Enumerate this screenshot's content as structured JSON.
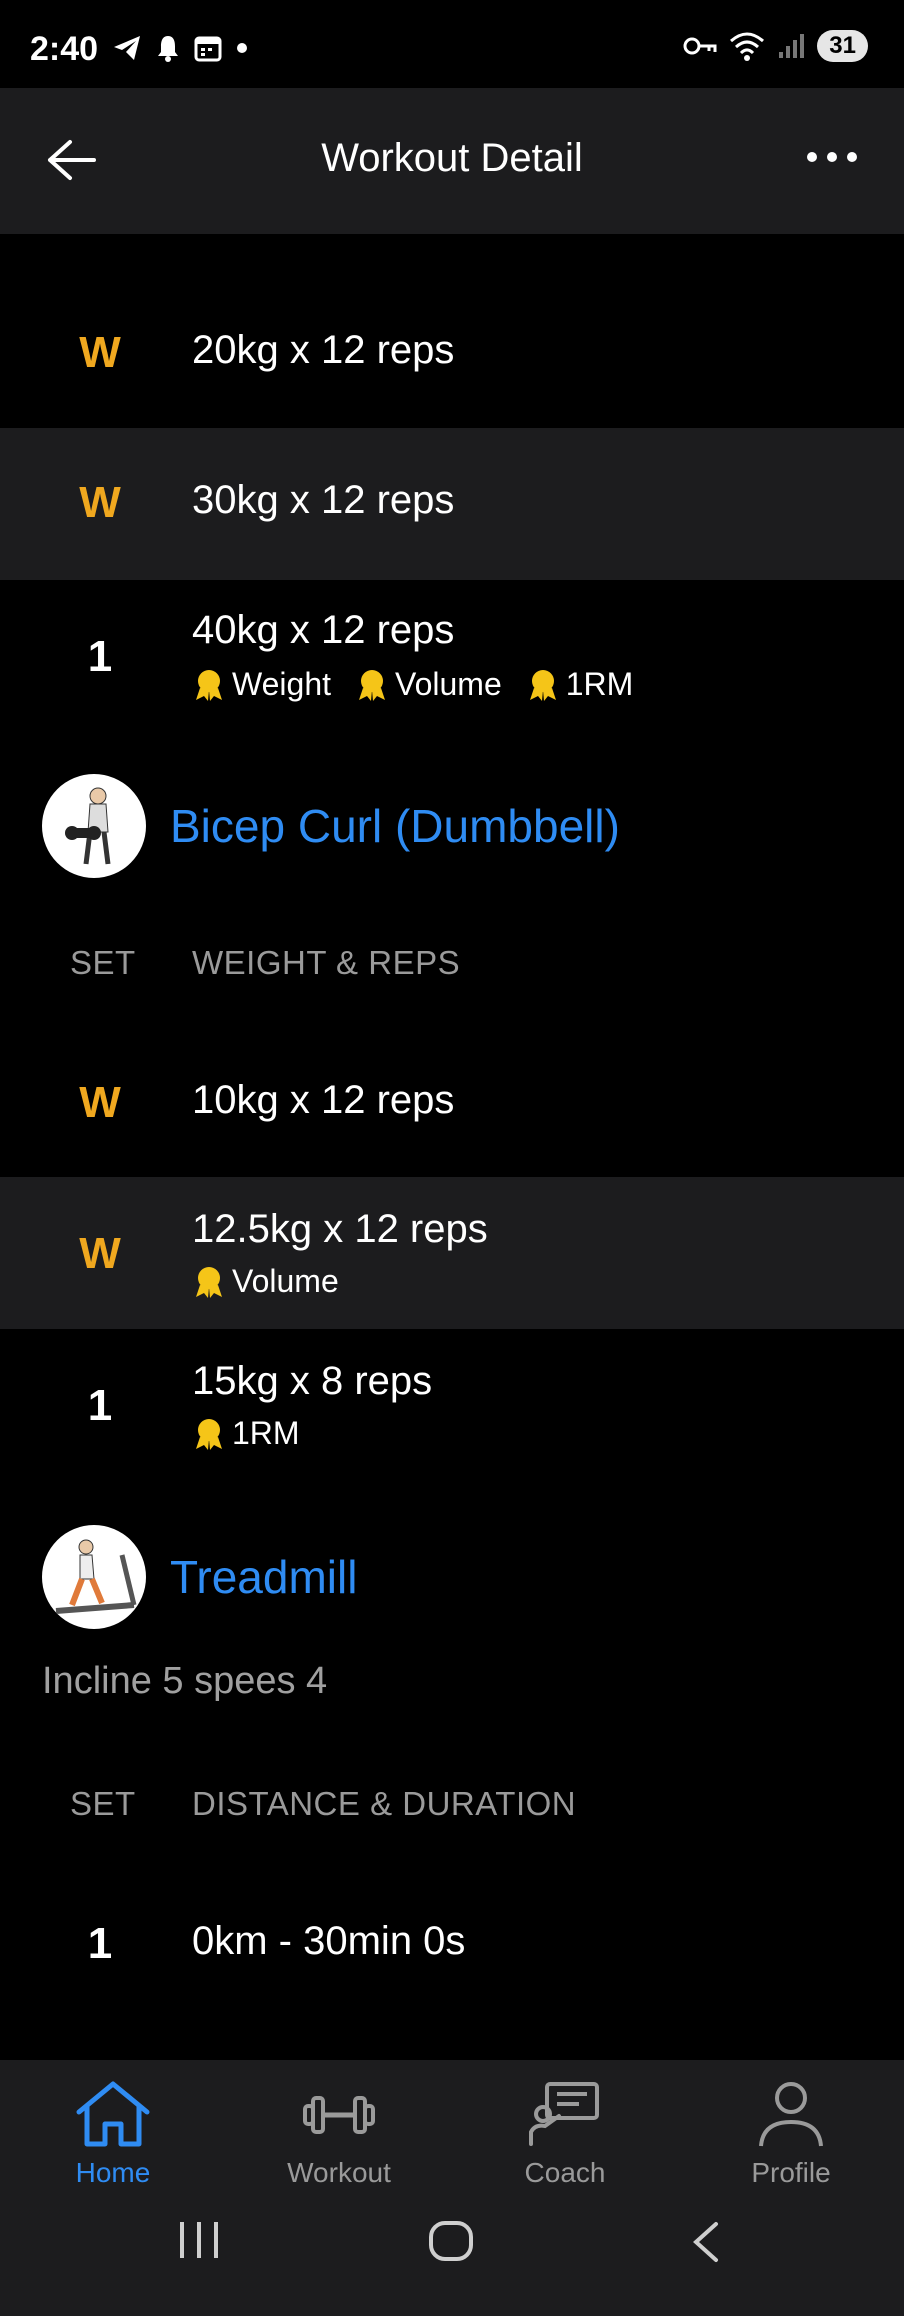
{
  "status_bar": {
    "time": "2:40",
    "battery": "31"
  },
  "header": {
    "title": "Workout Detail"
  },
  "sets_top": [
    {
      "set": "W",
      "text": "20kg x 12 reps",
      "badges": []
    },
    {
      "set": "W",
      "text": "30kg x 12 reps",
      "badges": []
    },
    {
      "set": "1",
      "text": "40kg x 12 reps",
      "badges": [
        "Weight",
        "Volume",
        "1RM"
      ]
    }
  ],
  "exercise1": {
    "title": "Bicep Curl (Dumbbell)",
    "columns": [
      "SET",
      "WEIGHT & REPS"
    ],
    "sets": [
      {
        "set": "W",
        "text": "10kg x 12 reps",
        "badges": []
      },
      {
        "set": "W",
        "text": "12.5kg x 12 reps",
        "badges": [
          "Volume"
        ]
      },
      {
        "set": "1",
        "text": "15kg x 8 reps",
        "badges": [
          "1RM"
        ]
      }
    ]
  },
  "exercise2": {
    "title": "Treadmill",
    "note": "Incline 5 spees 4",
    "columns": [
      "SET",
      "DISTANCE & DURATION"
    ],
    "sets": [
      {
        "set": "1",
        "text": "0km - 30min 0s"
      }
    ]
  },
  "nav": {
    "items": [
      {
        "label": "Home",
        "icon": "home-icon"
      },
      {
        "label": "Workout",
        "icon": "dumbbell-icon"
      },
      {
        "label": "Coach",
        "icon": "coach-icon"
      },
      {
        "label": "Profile",
        "icon": "profile-icon"
      }
    ]
  },
  "colors": {
    "accent_blue": "#2f8cf3",
    "warmup_orange": "#f0a81f",
    "medal_yellow": "#f5c518",
    "panel": "#1c1c1e"
  }
}
